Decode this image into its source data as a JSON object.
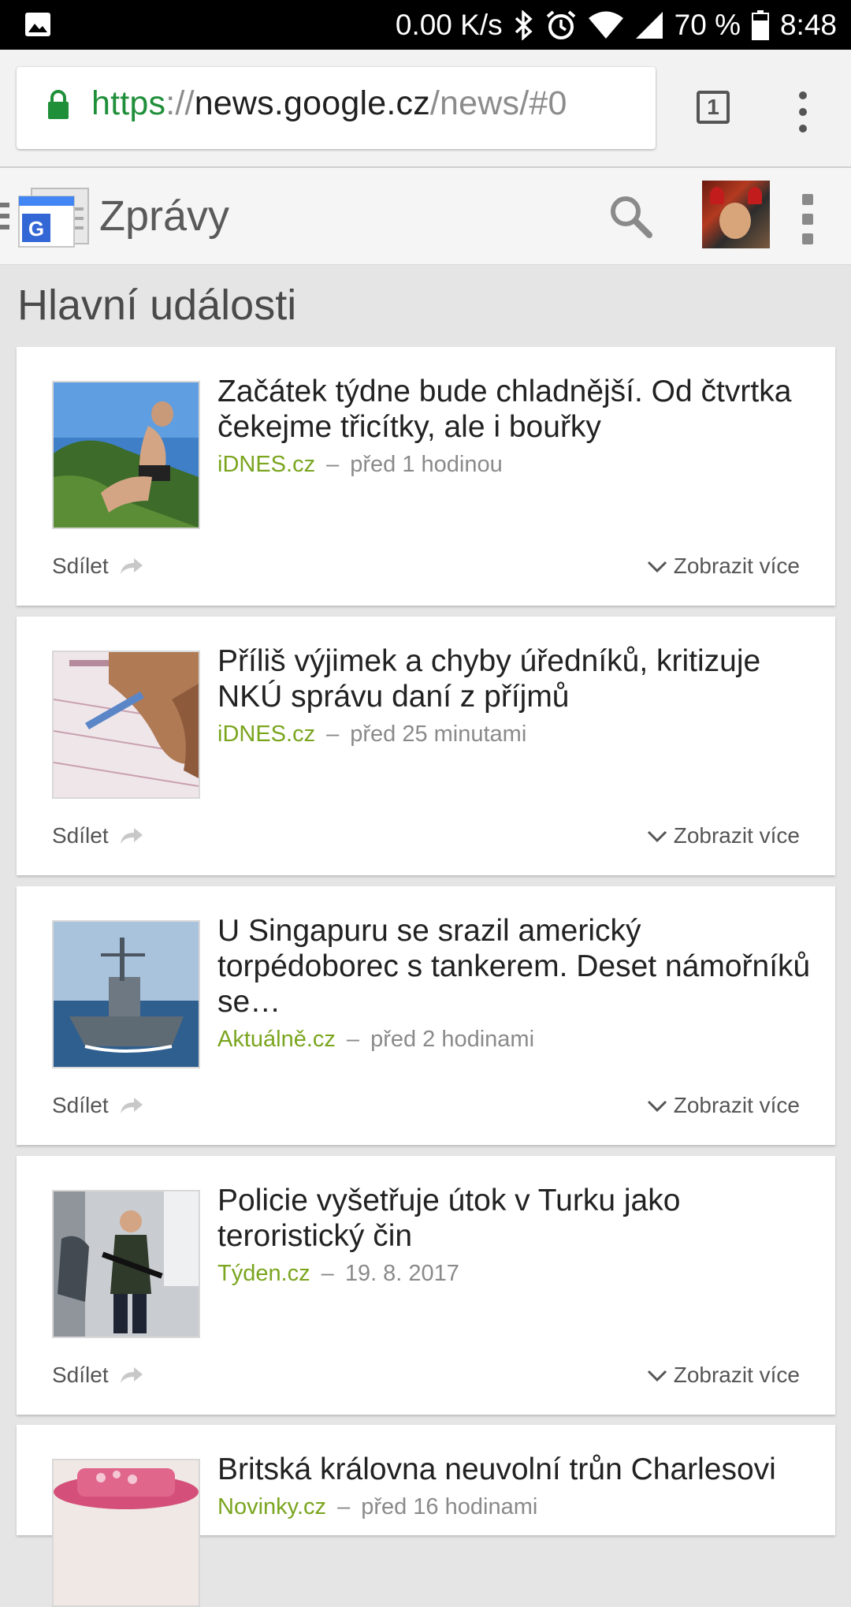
{
  "status_bar": {
    "net_speed": "0.00 K/s",
    "battery": "70 %",
    "time": "8:48",
    "icons": [
      "gallery-icon",
      "bluetooth-icon",
      "alarm-icon",
      "wifi-icon",
      "signal-icon",
      "battery-icon"
    ]
  },
  "browser": {
    "url_scheme": "https",
    "url_sep": "://",
    "url_host": "news.google.cz",
    "url_path": "/news/#0",
    "tab_count": "1"
  },
  "app": {
    "title": "Zprávy"
  },
  "section_title": "Hlavní události",
  "articles": [
    {
      "headline": "Začátek týdne bude chladnější. Od čtvrtka čekejme třicítky, ale i bouřky",
      "source": "iDNES.cz",
      "dash": "–",
      "time": "před 1 hodinou",
      "share": "Sdílet",
      "more": "Zobrazit více"
    },
    {
      "headline": "Příliš výjimek a chyby úředníků, kritizuje NKÚ správu daní z příjmů",
      "source": "iDNES.cz",
      "dash": "–",
      "time": "před 25 minutami",
      "share": "Sdílet",
      "more": "Zobrazit více"
    },
    {
      "headline": "U Singapuru se srazil americký torpédoborec s tankerem. Deset námořníků se…",
      "source": "Aktuálně.cz",
      "dash": "–",
      "time": "před 2 hodinami",
      "share": "Sdílet",
      "more": "Zobrazit více"
    },
    {
      "headline": "Policie vyšetřuje útok v Turku jako teroristický čin",
      "source": "Týden.cz",
      "dash": "–",
      "time": "19. 8. 2017",
      "share": "Sdílet",
      "more": "Zobrazit více"
    },
    {
      "headline": "Britská královna neuvolní trůn Charlesovi",
      "source": "Novinky.cz",
      "dash": "–",
      "time": "před 16 hodinami"
    }
  ],
  "colors": {
    "source_green": "#7aa51f",
    "url_green": "#1f8f3a",
    "background": "#e5e5e5"
  }
}
